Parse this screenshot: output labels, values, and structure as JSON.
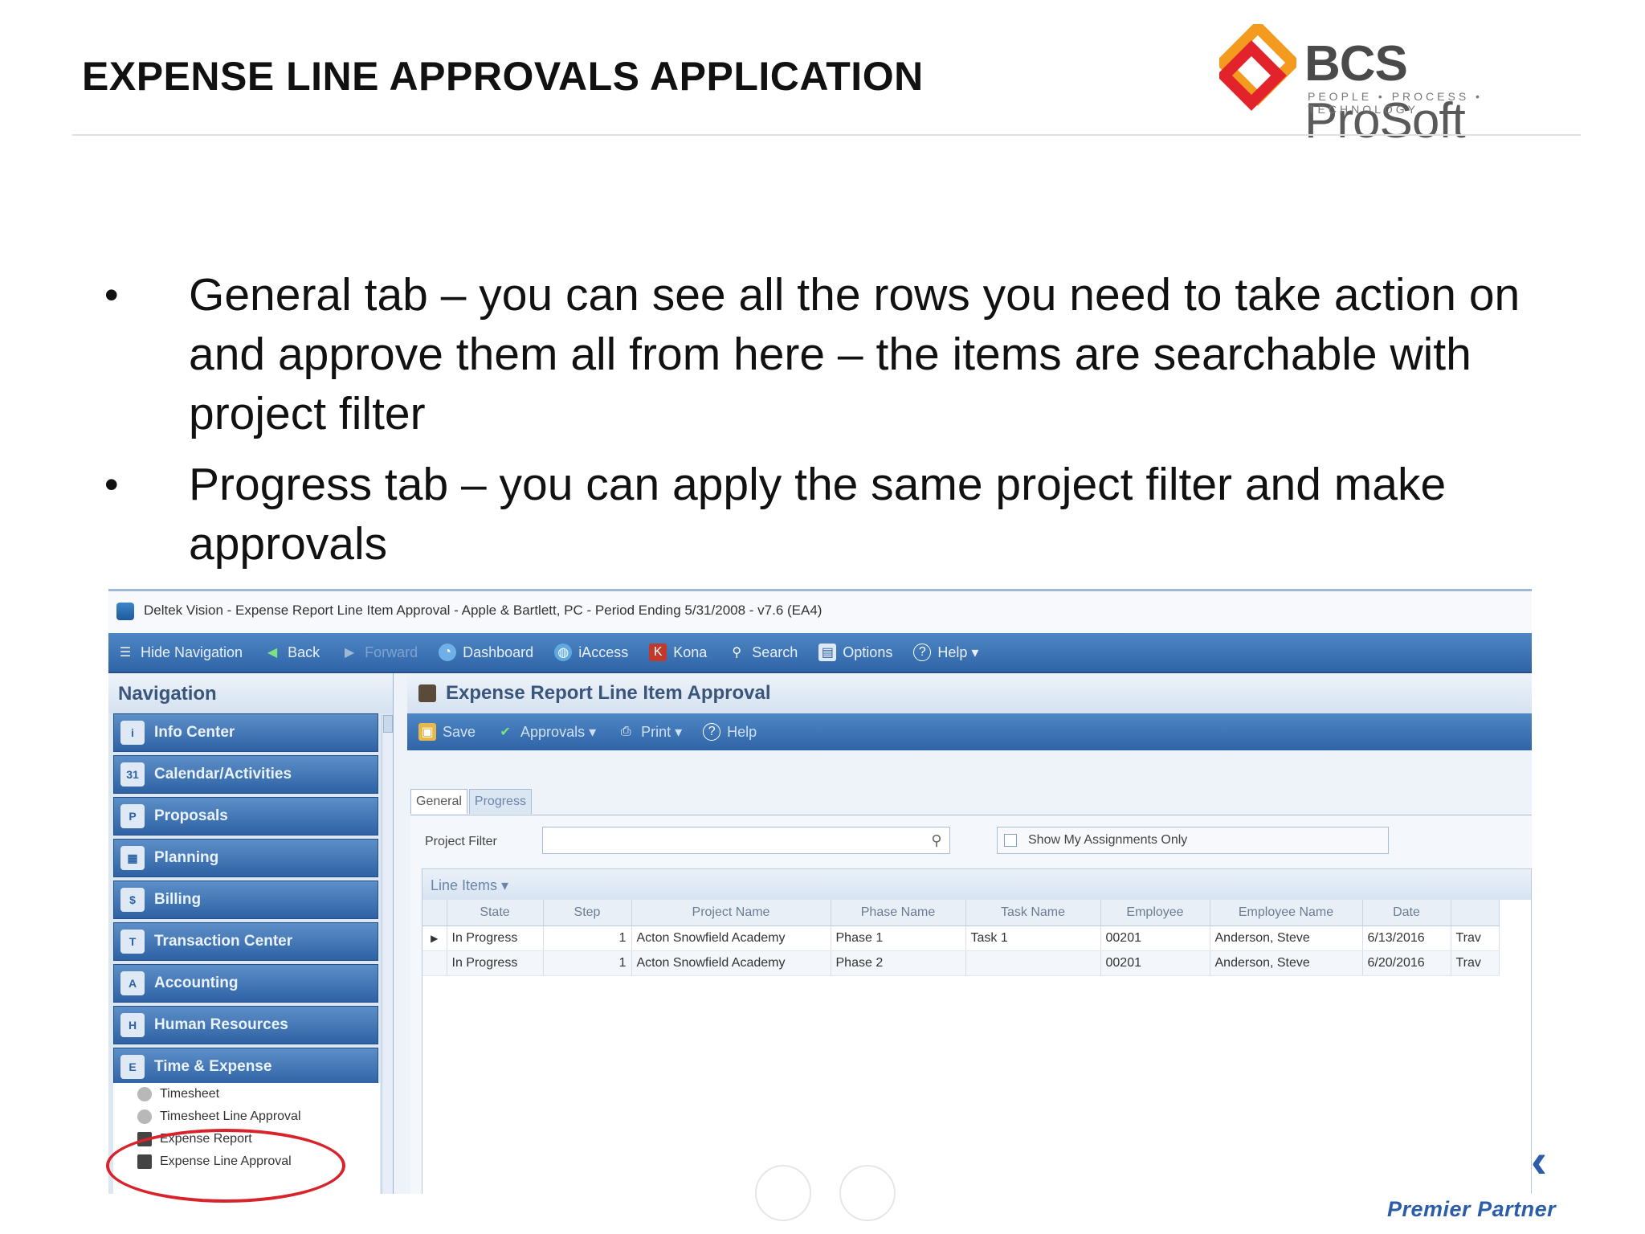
{
  "slide": {
    "title": "EXPENSE LINE APPROVALS APPLICATION",
    "logo_name_bold": "BCS",
    "logo_name_rest": " ProSoft",
    "logo_tagline": "PEOPLE • PROCESS • TECHNOLOGY",
    "bullet_glyph": "•",
    "bullets": [
      "General tab – you can see all the rows you need to take action on and approve them all from here – the items are searchable with project filter",
      "Progress tab – you can apply the same project filter and make approvals"
    ],
    "partner": "Premier Partner"
  },
  "app": {
    "window_title": "Deltek Vision - Expense Report Line Item Approval - Apple & Bartlett, PC - Period Ending 5/31/2008 - v7.6 (EA4)",
    "toolbar": [
      {
        "label": "Hide Navigation",
        "icon": "hide-navigation-icon"
      },
      {
        "label": "Back",
        "icon": "back-arrow-icon"
      },
      {
        "label": "Forward",
        "icon": "forward-arrow-icon",
        "disabled": true
      },
      {
        "label": "Dashboard",
        "icon": "dashboard-icon"
      },
      {
        "label": "iAccess",
        "icon": "globe-icon"
      },
      {
        "label": "Kona",
        "icon": "kona-icon"
      },
      {
        "label": "Search",
        "icon": "search-icon"
      },
      {
        "label": "Options",
        "icon": "options-icon"
      },
      {
        "label": "Help ▾",
        "icon": "help-icon"
      }
    ],
    "navigation": {
      "heading": "Navigation",
      "items": [
        {
          "label": "Info Center",
          "icon": "info-center-icon",
          "glyph": "i"
        },
        {
          "label": "Calendar/Activities",
          "icon": "calendar-icon",
          "glyph": "31"
        },
        {
          "label": "Proposals",
          "icon": "proposals-icon",
          "glyph": "P"
        },
        {
          "label": "Planning",
          "icon": "planning-icon",
          "glyph": "▦"
        },
        {
          "label": "Billing",
          "icon": "billing-icon",
          "glyph": "$"
        },
        {
          "label": "Transaction Center",
          "icon": "transaction-center-icon",
          "glyph": "T"
        },
        {
          "label": "Accounting",
          "icon": "accounting-icon",
          "glyph": "A"
        },
        {
          "label": "Human Resources",
          "icon": "human-resources-icon",
          "glyph": "H"
        },
        {
          "label": "Time & Expense",
          "icon": "time-expense-icon",
          "glyph": "E"
        }
      ],
      "sub_items": [
        {
          "label": "Timesheet",
          "icon": "timesheet-icon"
        },
        {
          "label": "Timesheet Line Approval",
          "icon": "timesheet-approval-icon"
        },
        {
          "label": "Expense Report",
          "icon": "expense-report-icon"
        },
        {
          "label": "Expense Line Approval",
          "icon": "expense-line-approval-icon"
        }
      ]
    },
    "main": {
      "heading": "Expense Report Line Item Approval",
      "toolbar": [
        {
          "label": "Save",
          "icon": "save-icon"
        },
        {
          "label": "Approvals ▾",
          "icon": "approvals-icon"
        },
        {
          "label": "Print ▾",
          "icon": "print-icon"
        },
        {
          "label": "Help",
          "icon": "help-icon"
        }
      ],
      "tabs": [
        "General",
        "Progress"
      ],
      "project_filter_label": "Project Filter",
      "project_filter_value": "",
      "show_my_assignments_label": "Show My Assignments Only",
      "grid_caption": "Line Items ▾",
      "columns": [
        "",
        "State",
        "Step",
        "Project Name",
        "Phase Name",
        "Task Name",
        "Employee",
        "Employee Name",
        "Date",
        ""
      ],
      "rows": [
        {
          "indicator": "▶",
          "state": "In Progress",
          "step": "1",
          "project": "Acton Snowfield Academy",
          "phase": "Phase 1",
          "task": "Task 1",
          "employee": "00201",
          "employee_name": "Anderson, Steve",
          "date": "6/13/2016",
          "extra": "Trav"
        },
        {
          "indicator": "",
          "state": "In Progress",
          "step": "1",
          "project": "Acton Snowfield Academy",
          "phase": "Phase 2",
          "task": "",
          "employee": "00201",
          "employee_name": "Anderson, Steve",
          "date": "6/20/2016",
          "extra": "Trav"
        }
      ]
    }
  },
  "colors": {
    "toolbar_blue": "#2f65a8",
    "highlight_red": "#d9232a",
    "partner_blue": "#2c5da8",
    "logo_red": "#e2232b",
    "logo_orange": "#f39a1f"
  }
}
